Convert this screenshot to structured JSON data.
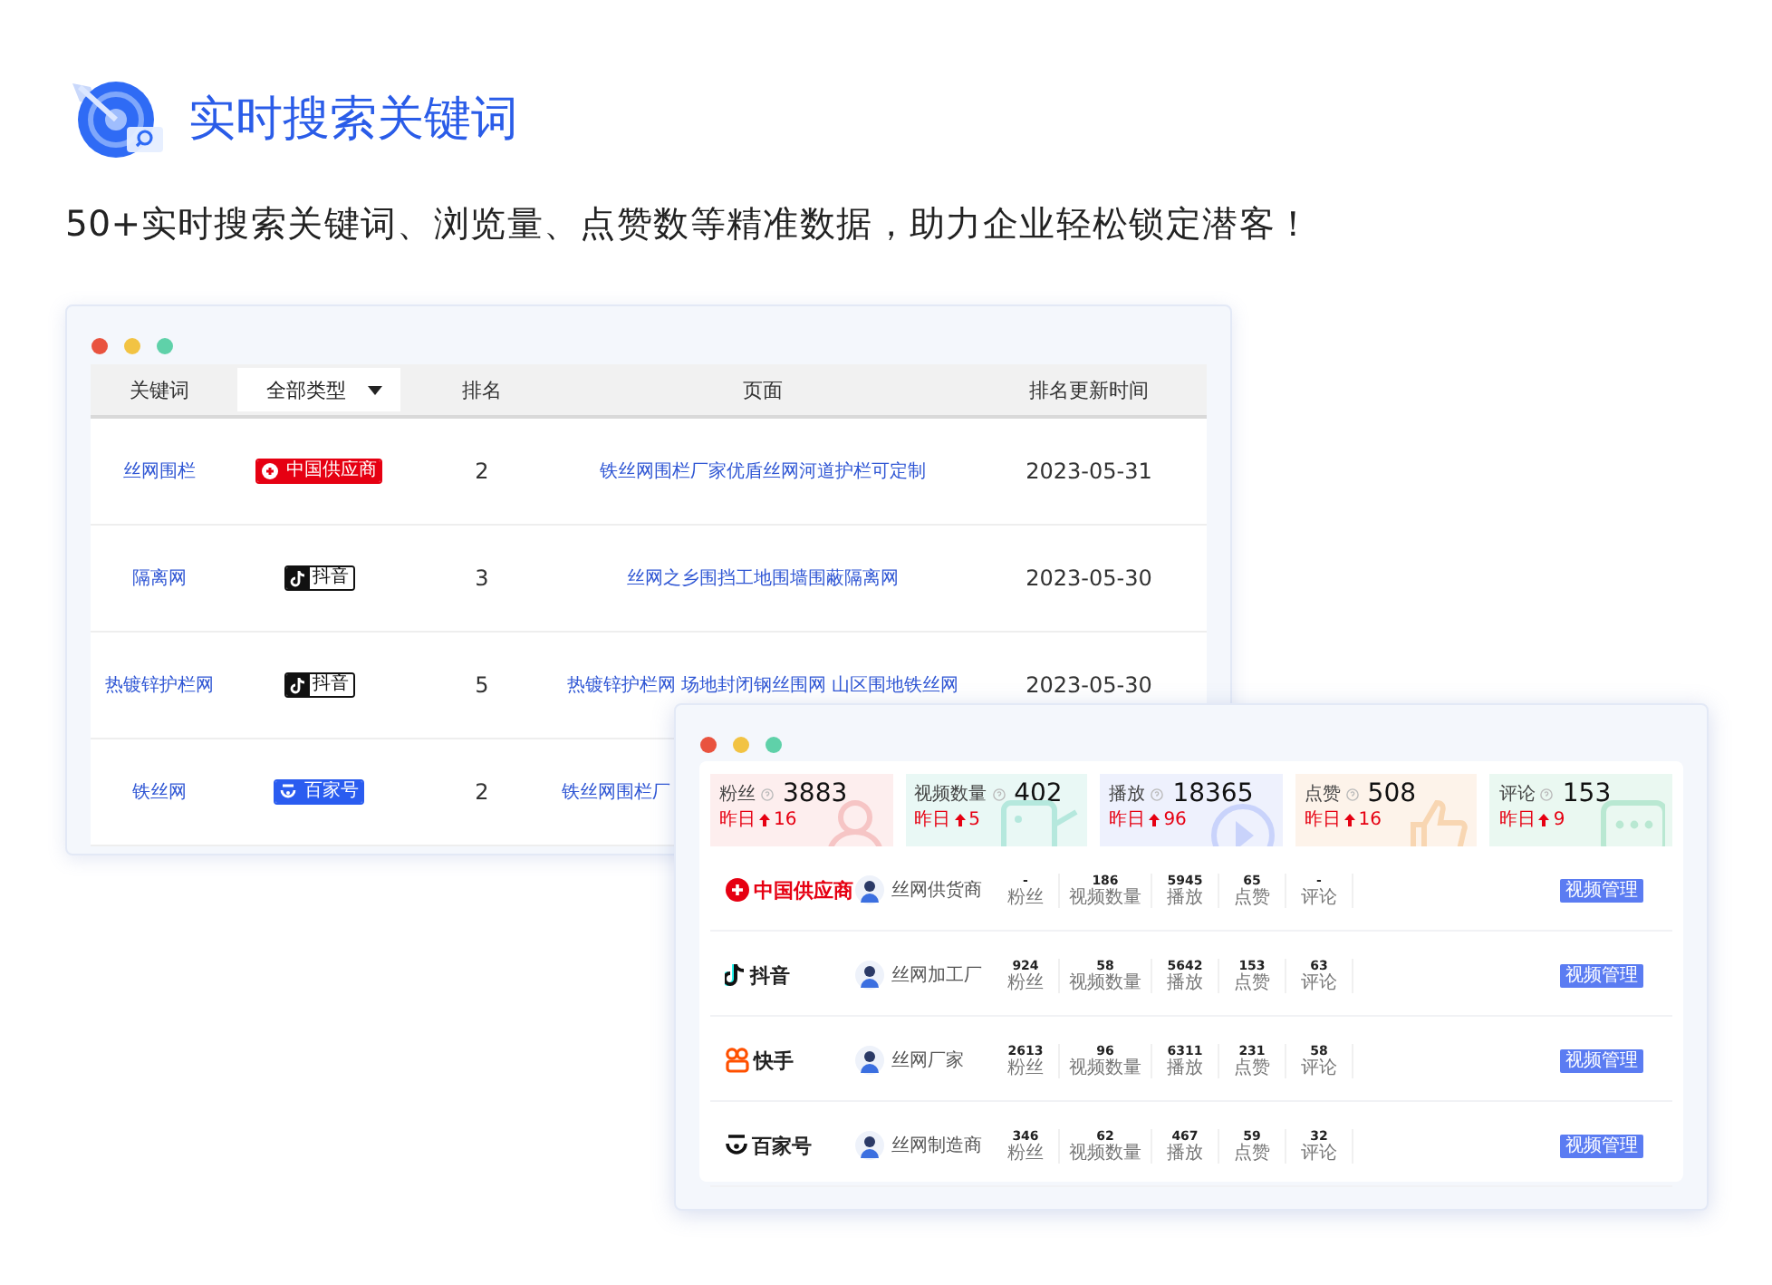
{
  "header": {
    "title": "实时搜索关键词",
    "subtitle": "50+实时搜索关键词、浏览量、点赞数等精准数据，助力企业轻松锁定潜客！"
  },
  "ranking_window": {
    "columns": [
      {
        "kind": "text",
        "label": "关键词"
      },
      {
        "kind": "dropdown",
        "label": "全部类型"
      },
      {
        "kind": "text",
        "label": "排名"
      },
      {
        "kind": "text",
        "label": "页面"
      },
      {
        "kind": "text",
        "label": "排名更新时间"
      }
    ],
    "rows": [
      {
        "keyword": "丝网围栏",
        "platform": {
          "kind": "supplier",
          "label": "中国供应商"
        },
        "rank": "2",
        "page": "铁丝网围栏厂家优盾丝网河道护栏可定制",
        "date": "2023-05-31"
      },
      {
        "keyword": "隔离网",
        "platform": {
          "kind": "douyin",
          "label": "抖音"
        },
        "rank": "3",
        "page": "丝网之乡围挡工地围墙围蔽隔离网",
        "date": "2023-05-30"
      },
      {
        "keyword": "热镀锌护栏网",
        "platform": {
          "kind": "douyin",
          "label": "抖音"
        },
        "rank": "5",
        "page": "热镀锌护栏网 场地封闭钢丝围网 山区围地铁丝网",
        "date": "2023-05-30"
      },
      {
        "keyword": "铁丝网",
        "platform": {
          "kind": "baijia",
          "label": "百家号"
        },
        "rank": "2",
        "page": "铁丝网围栏厂"
      }
    ]
  },
  "stats_window": {
    "cards": [
      {
        "kind": "fans",
        "label": "粉丝",
        "value": "3883",
        "delta_label": "昨日",
        "delta": "16",
        "color": "#fdeeee"
      },
      {
        "kind": "videos",
        "label": "视频数量",
        "value": "402",
        "delta_label": "昨日",
        "delta": "5",
        "color": "#e9f8f5"
      },
      {
        "kind": "plays",
        "label": "播放",
        "value": "18365",
        "delta_label": "昨日",
        "delta": "96",
        "color": "#eef1fd"
      },
      {
        "kind": "likes",
        "label": "点赞",
        "value": "508",
        "delta_label": "昨日",
        "delta": "16",
        "color": "#fdf3ea"
      },
      {
        "kind": "comments",
        "label": "评论",
        "value": "153",
        "delta_label": "昨日",
        "delta": "9",
        "color": "#eaf8f1"
      }
    ],
    "accounts": [
      {
        "platform": {
          "kind": "supplier",
          "label": "中国供应商"
        },
        "name": "丝网供货商",
        "metrics": [
          {
            "value": "-",
            "label": "粉丝"
          },
          {
            "value": "186",
            "label": "视频数量"
          },
          {
            "value": "5945",
            "label": "播放"
          },
          {
            "value": "65",
            "label": "点赞"
          },
          {
            "value": "-",
            "label": "评论"
          }
        ],
        "button": "视频管理"
      },
      {
        "platform": {
          "kind": "douyin",
          "label": "抖音"
        },
        "name": "丝网加工厂",
        "metrics": [
          {
            "value": "924",
            "label": "粉丝"
          },
          {
            "value": "58",
            "label": "视频数量"
          },
          {
            "value": "5642",
            "label": "播放"
          },
          {
            "value": "153",
            "label": "点赞"
          },
          {
            "value": "63",
            "label": "评论"
          }
        ],
        "button": "视频管理"
      },
      {
        "platform": {
          "kind": "kuaishou",
          "label": "快手"
        },
        "name": "丝网厂家",
        "metrics": [
          {
            "value": "2613",
            "label": "粉丝"
          },
          {
            "value": "96",
            "label": "视频数量"
          },
          {
            "value": "6311",
            "label": "播放"
          },
          {
            "value": "231",
            "label": "点赞"
          },
          {
            "value": "58",
            "label": "评论"
          }
        ],
        "button": "视频管理"
      },
      {
        "platform": {
          "kind": "baijia",
          "label": "百家号"
        },
        "name": "丝网制造商",
        "metrics": [
          {
            "value": "346",
            "label": "粉丝"
          },
          {
            "value": "62",
            "label": "视频数量"
          },
          {
            "value": "467",
            "label": "播放"
          },
          {
            "value": "59",
            "label": "点赞"
          },
          {
            "value": "32",
            "label": "评论"
          }
        ],
        "button": "视频管理"
      }
    ]
  }
}
